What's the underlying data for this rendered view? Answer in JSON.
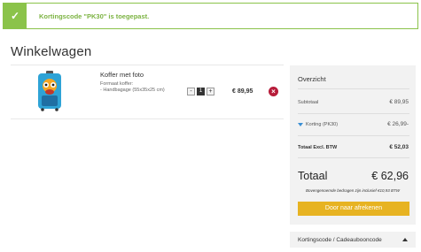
{
  "notice": {
    "message": "Kortingscode \"PK30\" is toegepast."
  },
  "page": {
    "title": "Winkelwagen"
  },
  "item": {
    "name": "Koffer met foto",
    "option_label": "Formaat koffer:",
    "option_value": "- Handbagage (55x35x25 cm)",
    "quantity": "1",
    "qty_minus": "-",
    "qty_plus": "+",
    "price": "€ 89,95",
    "remove": "×"
  },
  "summary": {
    "title": "Overzicht",
    "subtotal_label": "Subtotaal",
    "subtotal_value": "€ 89,95",
    "discount_label": "Korting (PK30)",
    "discount_value": "€ 26,99-",
    "excl_label": "Totaal Excl. BTW",
    "excl_value": "€ 52,03",
    "total_label": "Totaal",
    "total_value": "€ 62,96",
    "vat_note": "Bovengenoemde bedragen zijn inclusief €10,93 BTW",
    "checkout_label": "Door naar afrekenen"
  },
  "coupon": {
    "label": "Kortingscode / Cadeaubooncode"
  },
  "colors": {
    "success": "#8bc34a",
    "checkout": "#e7b322",
    "remove": "#b71c3a",
    "accent": "#3b8fd4"
  }
}
